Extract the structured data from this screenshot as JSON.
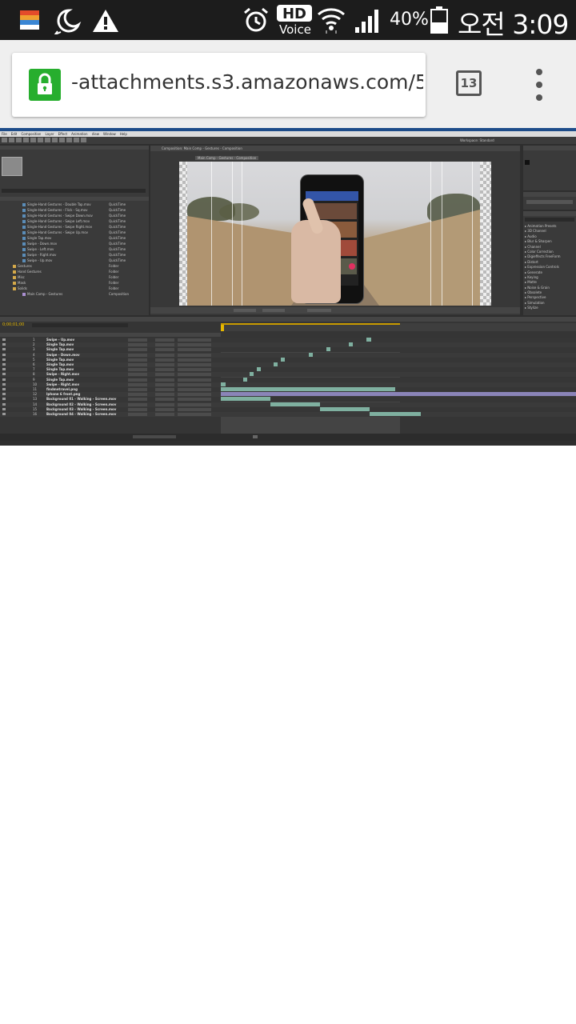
{
  "status_bar": {
    "battery_percent": "40%",
    "time": "오전 3:09",
    "hd_label": "HD",
    "voice_label": "Voice",
    "icons": [
      "app-notification-icon",
      "moon-icon",
      "warning-icon",
      "alarm-icon",
      "wifi-icon",
      "signal-icon",
      "battery-icon"
    ]
  },
  "browser": {
    "url": "-attachments.s3.amazonaws.com/5",
    "tab_count": "13",
    "lock_color": "#27ae2e"
  },
  "after_effects": {
    "menu": [
      "File",
      "Edit",
      "Composition",
      "Layer",
      "Effect",
      "Animation",
      "View",
      "Window",
      "Help"
    ],
    "workspace": "Workspace: Standard",
    "comp_tab": "Composition: Main Comp - Gestures - Composition",
    "comp_subtab": "Main Comp - Gestures - Composition",
    "project_items": [
      {
        "name": "Single-Hand Gestures - Double Tap.mov",
        "type": "QuickTime",
        "icon": "#5a8db8"
      },
      {
        "name": "Single-Hand Gestures - Flick - Sq.mov",
        "type": "QuickTime",
        "icon": "#5a8db8"
      },
      {
        "name": "Single-Hand Gestures - Swipe Down.mov",
        "type": "QuickTime",
        "icon": "#5a8db8"
      },
      {
        "name": "Single-Hand Gestures - Swipe Left.mov",
        "type": "QuickTime",
        "icon": "#5a8db8"
      },
      {
        "name": "Single-Hand Gestures - Swipe Right.mov",
        "type": "QuickTime",
        "icon": "#5a8db8"
      },
      {
        "name": "Single-Hand Gestures - Swipe Up.mov",
        "type": "QuickTime",
        "icon": "#5a8db8"
      },
      {
        "name": "Single Tap.mov",
        "type": "QuickTime",
        "icon": "#5a8db8"
      },
      {
        "name": "Swipe - Down.mov",
        "type": "QuickTime",
        "icon": "#5a8db8"
      },
      {
        "name": "Swipe - Left.mov",
        "type": "QuickTime",
        "icon": "#5a8db8"
      },
      {
        "name": "Swipe - Right.mov",
        "type": "QuickTime",
        "icon": "#5a8db8"
      },
      {
        "name": "Swipe - Up.mov",
        "type": "QuickTime",
        "icon": "#5a8db8"
      },
      {
        "name": "Gestures",
        "type": "Folder",
        "icon": "#d4a94a"
      },
      {
        "name": "Hand Gestures",
        "type": "Folder",
        "icon": "#d4a94a"
      },
      {
        "name": "Misc",
        "type": "Folder",
        "icon": "#d4a94a"
      },
      {
        "name": "Mask",
        "type": "Folder",
        "icon": "#d4a94a"
      },
      {
        "name": "Solids",
        "type": "Folder",
        "icon": "#d4a94a"
      },
      {
        "name": "Main Comp - Gestures",
        "type": "Composition",
        "icon": "#a98ed0"
      }
    ],
    "effects_list": [
      "Animation Presets",
      "3D Channel",
      "Audio",
      "Blur & Sharpen",
      "Channel",
      "Color Correction",
      "Digieffects FreeForm",
      "Distort",
      "Expression Controls",
      "Generate",
      "Keying",
      "Matte",
      "Noise & Grain",
      "Obsolete",
      "Perspective",
      "Simulation",
      "Stylize"
    ],
    "timecode": "0;00;01;00",
    "layers": [
      {
        "num": "1",
        "name": "Swipe - Up.mov"
      },
      {
        "num": "2",
        "name": "Single Tap.mov"
      },
      {
        "name": "Single Tap.mov",
        "num": "3"
      },
      {
        "num": "4",
        "name": "Swipe - Down.mov"
      },
      {
        "num": "5",
        "name": "Single Tap.mov"
      },
      {
        "num": "6",
        "name": "Single Tap.mov"
      },
      {
        "num": "7",
        "name": "Single Tap.mov"
      },
      {
        "num": "8",
        "name": "Swipe - Right.mov"
      },
      {
        "num": "9",
        "name": "Single Tap.mov"
      },
      {
        "num": "10",
        "name": "Swipe - Right.mov"
      },
      {
        "num": "11",
        "name": "findmetravel.png"
      },
      {
        "num": "12",
        "name": "Iphone 6 front.png"
      },
      {
        "num": "13",
        "name": "Background 01 - Walking - Screen.mov"
      },
      {
        "num": "14",
        "name": "Background 02 - Walking - Screen.mov"
      },
      {
        "num": "15",
        "name": "Background 03 - Walking - Screen.mov"
      },
      {
        "num": "16",
        "name": "Background 04 - Walking - Screen.mov"
      }
    ],
    "colors": {
      "panel": "#3a3a3a",
      "clip": "#7fb0a0",
      "comp_bar": "#8a84b8",
      "timecode": "#e6b800",
      "phone_screen": "#3355a8"
    }
  }
}
